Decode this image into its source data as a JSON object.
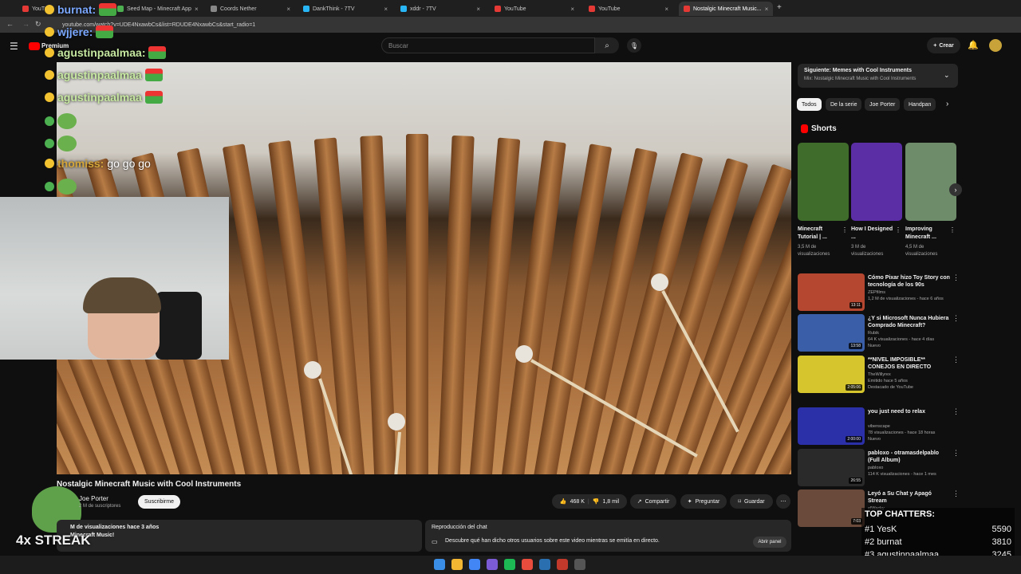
{
  "browser": {
    "tabs": [
      {
        "title": "YouTube",
        "color": "#e53935"
      },
      {
        "title": "Seed Map - Minecraft App",
        "color": "#4caf50"
      },
      {
        "title": "Coords Nether",
        "color": "#888888"
      },
      {
        "title": "DankThink - 7TV",
        "color": "#29b6f6"
      },
      {
        "title": "xddr - 7TV",
        "color": "#29b6f6"
      },
      {
        "title": "YouTube",
        "color": "#e53935"
      },
      {
        "title": "YouTube",
        "color": "#e53935"
      },
      {
        "title": "Nostalgic Minecraft Music...",
        "color": "#e53935"
      }
    ],
    "url": "youtube.com/watch?v=UDE4NxawbCs&list=RDUDE4NxawbCs&start_radio=1"
  },
  "youtube": {
    "logo": "Premium",
    "search_placeholder": "Buscar",
    "create_label": "Crear"
  },
  "chat_overlay": [
    {
      "user": "burnat:",
      "msg": "",
      "color": "#7aa7ff"
    },
    {
      "user": "wjjere:",
      "msg": "",
      "color": "#7aa7ff"
    },
    {
      "user": "agustinpaalmaa:",
      "msg": "",
      "color": "#c6e8a0"
    },
    {
      "user": "agustinpaalmaa",
      "msg": "",
      "color": "#c6e8a0"
    },
    {
      "user": "agustinpaalmaa",
      "msg": "",
      "color": "#c6e8a0"
    },
    {
      "user": "thomiss:",
      "msg": "go go go",
      "color": "#d4a63a"
    }
  ],
  "video": {
    "title": "Nostalgic Minecraft Music with Cool Instruments",
    "channel": "Joe Porter",
    "subs": "2 M de suscriptores",
    "subscribe": "Suscribirme",
    "likes": "468 K",
    "dislikes": "1,8 mil",
    "share": "Compartir",
    "ask": "Preguntar",
    "save": "Guardar",
    "desc_views": "M de visualizaciones  hace 3 años",
    "desc_text": "Minecraft Music!",
    "chat_replay_title": "Reproducción del chat",
    "chat_replay_text": "Descubre qué han dicho otros usuarios sobre este video mientras se emitía en directo.",
    "open_panel": "Abrir panel"
  },
  "streak": "4x STREAK",
  "sidebar": {
    "upnext_title": "Siguiente: Memes with Cool Instruments",
    "upnext_sub": "Mix: Nostalgic Minecraft Music with Cool Instruments",
    "chips": [
      "Todos",
      "De la serie",
      "Joe Porter",
      "Handpan"
    ],
    "shorts_header": "Shorts",
    "shorts": [
      {
        "title": "Minecraft Tutorial | ...",
        "views": "3,5 M de visualizaciones",
        "color": "#3f6b2b"
      },
      {
        "title": "How I Designed ...",
        "views": "3 M de visualizaciones",
        "color": "#5b2ea6"
      },
      {
        "title": "Improving Minecraft ...",
        "views": "4,5 M de visualizaciones",
        "color": "#6e8c6a"
      }
    ],
    "recs": [
      {
        "title": "Cómo Pixar hizo Toy Story con tecnología de los 90s",
        "channel": "ZEPfilms",
        "meta": "1,2 M de visualizaciones - hace 6 años",
        "duration": "13:11",
        "color": "#b5462f",
        "badge": ""
      },
      {
        "title": "¿Y si Microsoft Nunca Hubiera Comprado Minecraft?",
        "channel": "Rubik",
        "meta": "64 K visualizaciones - hace 4 días",
        "duration": "13:58",
        "color": "#3a5fa8",
        "badge": "Nuevo"
      },
      {
        "title": "**NIVEL IMPOSIBLE** CONEJOS EN DIRECTO",
        "channel": "TheWillyrex",
        "meta": "Emitido hace 5 años",
        "duration": "2:05:06",
        "color": "#d6c52c",
        "badge": "Destacado de YouTube"
      },
      {
        "title": "you just need to relax",
        "channel": "vibenscape",
        "meta": "78 visualizaciones - hace 18 horas",
        "duration": "2:00:00",
        "color": "#2b2fa8",
        "badge": "Nuevo"
      },
      {
        "title": "pabloxo - otramasdelpablo (Full Album)",
        "channel": "pabloxo",
        "meta": "114 K visualizaciones - hace 1 mes",
        "duration": "26:55",
        "color": "#2a2a2a",
        "badge": ""
      },
      {
        "title": "Leyó a Su Chat y Apagó Stream",
        "channel": "elWacky",
        "meta": "",
        "duration": "7:03",
        "color": "#6a4a3a",
        "badge": ""
      }
    ]
  },
  "top_chatters": {
    "title": "TOP CHATTERS:",
    "rows": [
      {
        "rank": "#1",
        "name": "YesK",
        "count": "5590"
      },
      {
        "rank": "#2",
        "name": "burnat",
        "count": "3810"
      },
      {
        "rank": "#3",
        "name": "agustinpaalmaa",
        "count": "3245"
      }
    ]
  }
}
